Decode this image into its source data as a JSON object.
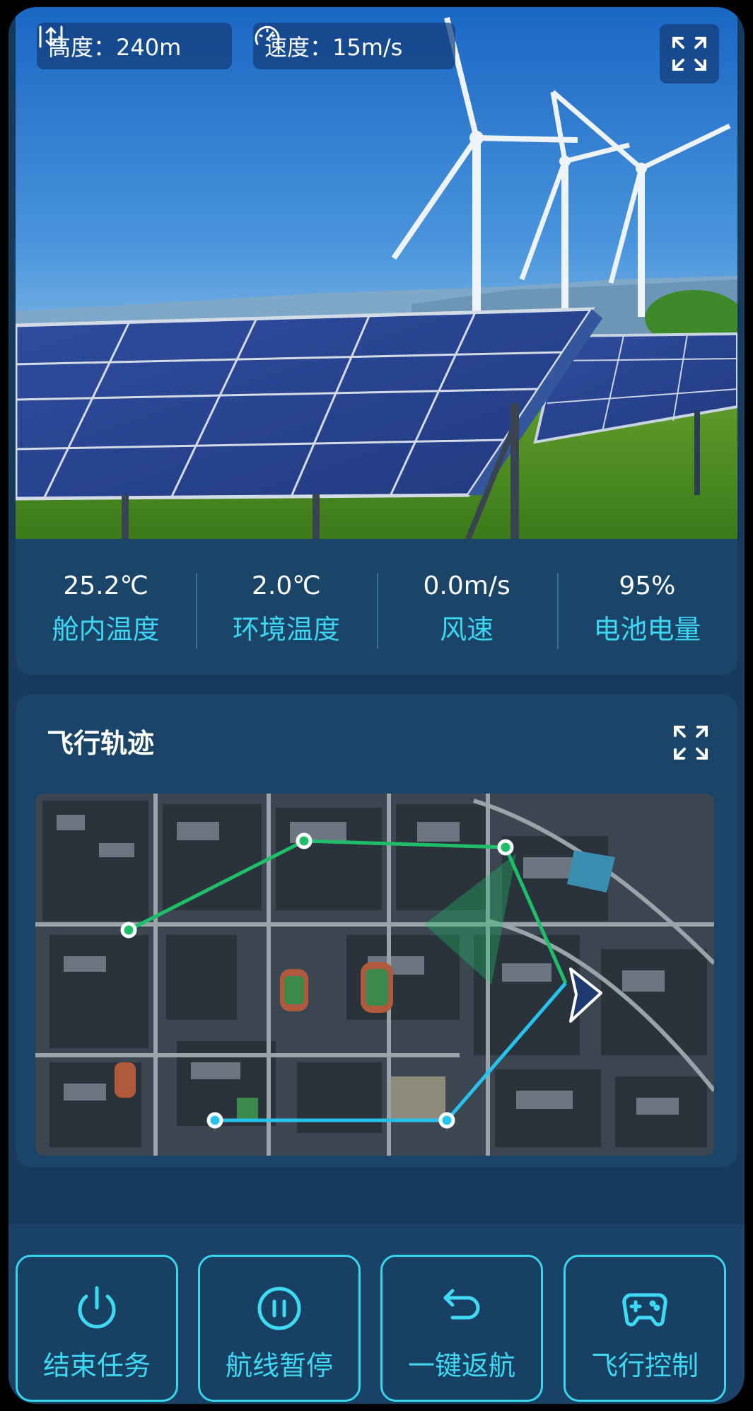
{
  "video": {
    "altitude": "高度：240m",
    "speed": "速度：15m/s",
    "icons": {
      "altitude": "altitude-arrows-icon",
      "speed": "speedometer-icon",
      "fullscreen": "fullscreen-icon"
    }
  },
  "stats": [
    {
      "value": "25.2℃",
      "label": "舱内温度"
    },
    {
      "value": "2.0℃",
      "label": "环境温度"
    },
    {
      "value": "0.0m/s",
      "label": "风速"
    },
    {
      "value": "95%",
      "label": "电池电量"
    }
  ],
  "track": {
    "title": "飞行轨迹",
    "icons": {
      "fullscreen": "fullscreen-icon",
      "drone": "drone-arrow-icon"
    },
    "colors": {
      "flown": "#1fbf6a",
      "planned": "#28c2ee",
      "drone": "#1e3a6e"
    }
  },
  "actions": [
    {
      "label": "结束任务",
      "icon": "power-icon"
    },
    {
      "label": "航线暂停",
      "icon": "pause-icon"
    },
    {
      "label": "一键返航",
      "icon": "return-icon"
    },
    {
      "label": "飞行控制",
      "icon": "gamepad-icon"
    }
  ],
  "colors": {
    "accent": "#3ed6f2",
    "panel": "#1b4568",
    "background": "#173a5c"
  }
}
